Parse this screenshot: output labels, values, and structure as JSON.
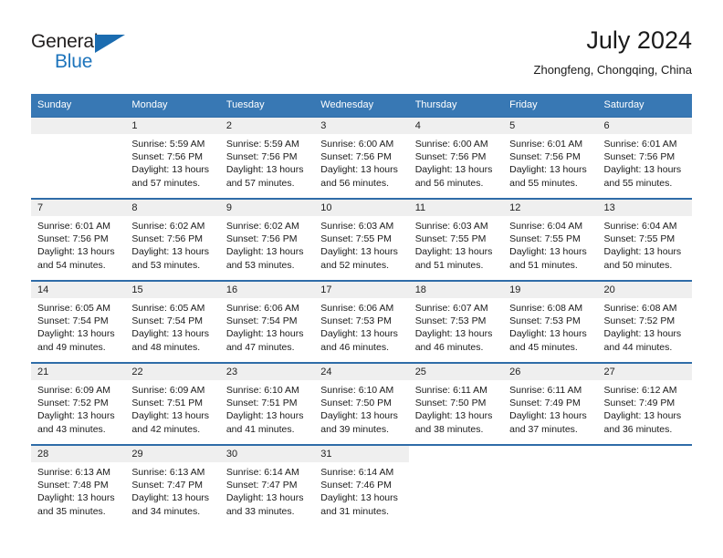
{
  "brand": {
    "name_part1": "General",
    "name_part2": "Blue",
    "triangle_icon": "triangle-logo-icon"
  },
  "header": {
    "title": "July 2024",
    "subtitle": "Zhongfeng, Chongqing, China"
  },
  "colors": {
    "header_blue": "#3878b4",
    "row_border_blue": "#2f6ca8",
    "day_band_gray": "#efefef",
    "brand_blue": "#1d74bc"
  },
  "weekdays": [
    "Sunday",
    "Monday",
    "Tuesday",
    "Wednesday",
    "Thursday",
    "Friday",
    "Saturday"
  ],
  "weeks": [
    [
      {
        "day": "",
        "empty": true,
        "sunrise": "",
        "sunset": "",
        "daylight1": "",
        "daylight2": ""
      },
      {
        "day": "1",
        "sunrise": "Sunrise: 5:59 AM",
        "sunset": "Sunset: 7:56 PM",
        "daylight1": "Daylight: 13 hours",
        "daylight2": "and 57 minutes."
      },
      {
        "day": "2",
        "sunrise": "Sunrise: 5:59 AM",
        "sunset": "Sunset: 7:56 PM",
        "daylight1": "Daylight: 13 hours",
        "daylight2": "and 57 minutes."
      },
      {
        "day": "3",
        "sunrise": "Sunrise: 6:00 AM",
        "sunset": "Sunset: 7:56 PM",
        "daylight1": "Daylight: 13 hours",
        "daylight2": "and 56 minutes."
      },
      {
        "day": "4",
        "sunrise": "Sunrise: 6:00 AM",
        "sunset": "Sunset: 7:56 PM",
        "daylight1": "Daylight: 13 hours",
        "daylight2": "and 56 minutes."
      },
      {
        "day": "5",
        "sunrise": "Sunrise: 6:01 AM",
        "sunset": "Sunset: 7:56 PM",
        "daylight1": "Daylight: 13 hours",
        "daylight2": "and 55 minutes."
      },
      {
        "day": "6",
        "sunrise": "Sunrise: 6:01 AM",
        "sunset": "Sunset: 7:56 PM",
        "daylight1": "Daylight: 13 hours",
        "daylight2": "and 55 minutes."
      }
    ],
    [
      {
        "day": "7",
        "sunrise": "Sunrise: 6:01 AM",
        "sunset": "Sunset: 7:56 PM",
        "daylight1": "Daylight: 13 hours",
        "daylight2": "and 54 minutes."
      },
      {
        "day": "8",
        "sunrise": "Sunrise: 6:02 AM",
        "sunset": "Sunset: 7:56 PM",
        "daylight1": "Daylight: 13 hours",
        "daylight2": "and 53 minutes."
      },
      {
        "day": "9",
        "sunrise": "Sunrise: 6:02 AM",
        "sunset": "Sunset: 7:56 PM",
        "daylight1": "Daylight: 13 hours",
        "daylight2": "and 53 minutes."
      },
      {
        "day": "10",
        "sunrise": "Sunrise: 6:03 AM",
        "sunset": "Sunset: 7:55 PM",
        "daylight1": "Daylight: 13 hours",
        "daylight2": "and 52 minutes."
      },
      {
        "day": "11",
        "sunrise": "Sunrise: 6:03 AM",
        "sunset": "Sunset: 7:55 PM",
        "daylight1": "Daylight: 13 hours",
        "daylight2": "and 51 minutes."
      },
      {
        "day": "12",
        "sunrise": "Sunrise: 6:04 AM",
        "sunset": "Sunset: 7:55 PM",
        "daylight1": "Daylight: 13 hours",
        "daylight2": "and 51 minutes."
      },
      {
        "day": "13",
        "sunrise": "Sunrise: 6:04 AM",
        "sunset": "Sunset: 7:55 PM",
        "daylight1": "Daylight: 13 hours",
        "daylight2": "and 50 minutes."
      }
    ],
    [
      {
        "day": "14",
        "sunrise": "Sunrise: 6:05 AM",
        "sunset": "Sunset: 7:54 PM",
        "daylight1": "Daylight: 13 hours",
        "daylight2": "and 49 minutes."
      },
      {
        "day": "15",
        "sunrise": "Sunrise: 6:05 AM",
        "sunset": "Sunset: 7:54 PM",
        "daylight1": "Daylight: 13 hours",
        "daylight2": "and 48 minutes."
      },
      {
        "day": "16",
        "sunrise": "Sunrise: 6:06 AM",
        "sunset": "Sunset: 7:54 PM",
        "daylight1": "Daylight: 13 hours",
        "daylight2": "and 47 minutes."
      },
      {
        "day": "17",
        "sunrise": "Sunrise: 6:06 AM",
        "sunset": "Sunset: 7:53 PM",
        "daylight1": "Daylight: 13 hours",
        "daylight2": "and 46 minutes."
      },
      {
        "day": "18",
        "sunrise": "Sunrise: 6:07 AM",
        "sunset": "Sunset: 7:53 PM",
        "daylight1": "Daylight: 13 hours",
        "daylight2": "and 46 minutes."
      },
      {
        "day": "19",
        "sunrise": "Sunrise: 6:08 AM",
        "sunset": "Sunset: 7:53 PM",
        "daylight1": "Daylight: 13 hours",
        "daylight2": "and 45 minutes."
      },
      {
        "day": "20",
        "sunrise": "Sunrise: 6:08 AM",
        "sunset": "Sunset: 7:52 PM",
        "daylight1": "Daylight: 13 hours",
        "daylight2": "and 44 minutes."
      }
    ],
    [
      {
        "day": "21",
        "sunrise": "Sunrise: 6:09 AM",
        "sunset": "Sunset: 7:52 PM",
        "daylight1": "Daylight: 13 hours",
        "daylight2": "and 43 minutes."
      },
      {
        "day": "22",
        "sunrise": "Sunrise: 6:09 AM",
        "sunset": "Sunset: 7:51 PM",
        "daylight1": "Daylight: 13 hours",
        "daylight2": "and 42 minutes."
      },
      {
        "day": "23",
        "sunrise": "Sunrise: 6:10 AM",
        "sunset": "Sunset: 7:51 PM",
        "daylight1": "Daylight: 13 hours",
        "daylight2": "and 41 minutes."
      },
      {
        "day": "24",
        "sunrise": "Sunrise: 6:10 AM",
        "sunset": "Sunset: 7:50 PM",
        "daylight1": "Daylight: 13 hours",
        "daylight2": "and 39 minutes."
      },
      {
        "day": "25",
        "sunrise": "Sunrise: 6:11 AM",
        "sunset": "Sunset: 7:50 PM",
        "daylight1": "Daylight: 13 hours",
        "daylight2": "and 38 minutes."
      },
      {
        "day": "26",
        "sunrise": "Sunrise: 6:11 AM",
        "sunset": "Sunset: 7:49 PM",
        "daylight1": "Daylight: 13 hours",
        "daylight2": "and 37 minutes."
      },
      {
        "day": "27",
        "sunrise": "Sunrise: 6:12 AM",
        "sunset": "Sunset: 7:49 PM",
        "daylight1": "Daylight: 13 hours",
        "daylight2": "and 36 minutes."
      }
    ],
    [
      {
        "day": "28",
        "sunrise": "Sunrise: 6:13 AM",
        "sunset": "Sunset: 7:48 PM",
        "daylight1": "Daylight: 13 hours",
        "daylight2": "and 35 minutes."
      },
      {
        "day": "29",
        "sunrise": "Sunrise: 6:13 AM",
        "sunset": "Sunset: 7:47 PM",
        "daylight1": "Daylight: 13 hours",
        "daylight2": "and 34 minutes."
      },
      {
        "day": "30",
        "sunrise": "Sunrise: 6:14 AM",
        "sunset": "Sunset: 7:47 PM",
        "daylight1": "Daylight: 13 hours",
        "daylight2": "and 33 minutes."
      },
      {
        "day": "31",
        "sunrise": "Sunrise: 6:14 AM",
        "sunset": "Sunset: 7:46 PM",
        "daylight1": "Daylight: 13 hours",
        "daylight2": "and 31 minutes."
      },
      {
        "day": "",
        "blank": true,
        "sunrise": "",
        "sunset": "",
        "daylight1": "",
        "daylight2": ""
      },
      {
        "day": "",
        "blank": true,
        "sunrise": "",
        "sunset": "",
        "daylight1": "",
        "daylight2": ""
      },
      {
        "day": "",
        "blank": true,
        "sunrise": "",
        "sunset": "",
        "daylight1": "",
        "daylight2": ""
      }
    ]
  ]
}
